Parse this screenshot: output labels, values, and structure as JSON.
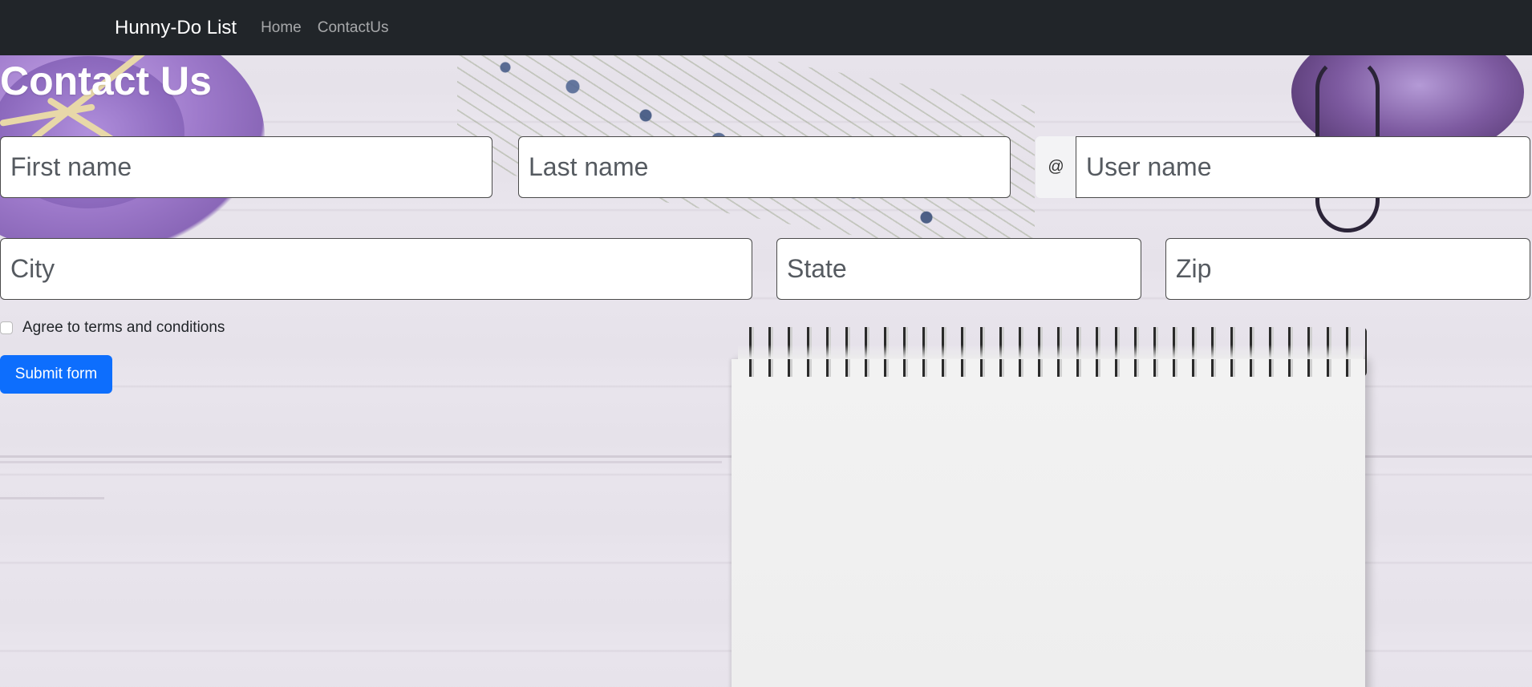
{
  "navbar": {
    "brand": "Hunny-Do List",
    "links": [
      "Home",
      "ContactUs"
    ]
  },
  "page": {
    "title": "Contact Us"
  },
  "form": {
    "first_name_placeholder": "First name",
    "last_name_placeholder": "Last name",
    "username_addon": "@",
    "username_placeholder": "User name",
    "city_placeholder": "City",
    "state_placeholder": "State",
    "zip_placeholder": "Zip",
    "terms_label": "Agree to terms and conditions",
    "terms_checked": false,
    "submit_label": "Submit form"
  },
  "colors": {
    "navbar_bg": "#212529",
    "primary_button": "#0d6efd"
  }
}
